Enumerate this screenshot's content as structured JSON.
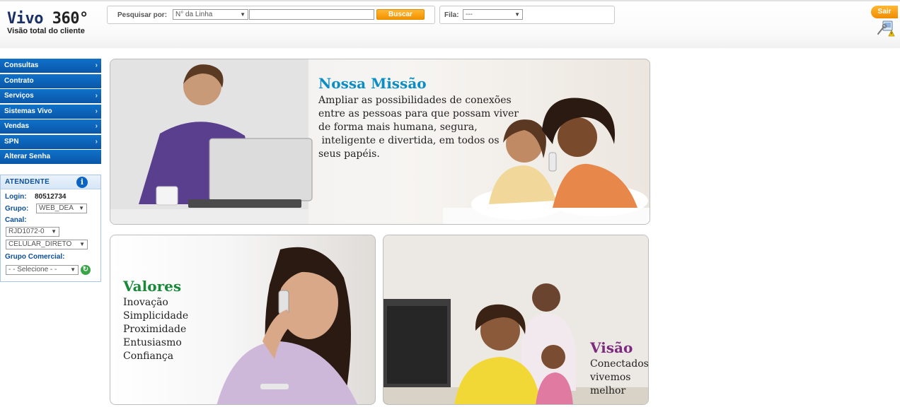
{
  "brand": {
    "name": "Vivo",
    "number": "360°",
    "subtitle": "Visão total do cliente"
  },
  "search": {
    "label": "Pesquisar por:",
    "type_selected": "N° da Linha",
    "query_value": "",
    "button_label": "Buscar"
  },
  "queue": {
    "label": "Fila:",
    "selected": "---"
  },
  "header": {
    "logout_label": "Sair"
  },
  "sidebar": {
    "items": [
      {
        "label": "Consultas",
        "submenu": true
      },
      {
        "label": "Contrato",
        "submenu": false
      },
      {
        "label": "Serviços",
        "submenu": true
      },
      {
        "label": "Sistemas Vivo",
        "submenu": true
      },
      {
        "label": "Vendas",
        "submenu": true
      },
      {
        "label": "SPN",
        "submenu": true
      },
      {
        "label": "Alterar Senha",
        "submenu": false
      }
    ],
    "chevron": "›"
  },
  "attendant": {
    "title": "ATENDENTE",
    "login_label": "Login:",
    "login_value": "80512734",
    "group_label": "Grupo:",
    "group_value": "WEB_DEA",
    "channel_label": "Canal:",
    "channel_code": "RJD1072-0",
    "channel_type": "CELULAR_DIRETO",
    "commercial_group_label": "Grupo Comercial:",
    "commercial_group_value": "- - Selecione - -"
  },
  "panels": {
    "mission": {
      "title": "Nossa Missão",
      "lines": [
        "Ampliar as possibilidades de conexões",
        "entre as pessoas para que possam viver",
        "de forma mais humana, segura,",
        " inteligente e divertida, em todos os",
        "seus papéis."
      ]
    },
    "values": {
      "title": "Valores",
      "lines": [
        "Inovação",
        "Simplicidade",
        "Proximidade",
        "Entusiasmo",
        "Confiança"
      ]
    },
    "vision": {
      "title": "Visão",
      "lines": [
        "Conectados",
        "vivemos",
        "melhor"
      ]
    }
  },
  "colors": {
    "menu_blue": "#0a56a8",
    "accent_orange": "#f39200",
    "mission_blue": "#0a8ec4",
    "values_green": "#1a8a3a",
    "vision_purple": "#7d2a7e"
  },
  "icons": {
    "info": "info-icon",
    "refresh": "refresh-icon",
    "tools": "tools-warning-icon",
    "dropdown": "chevron-down-icon",
    "submenu": "chevron-right-icon"
  }
}
